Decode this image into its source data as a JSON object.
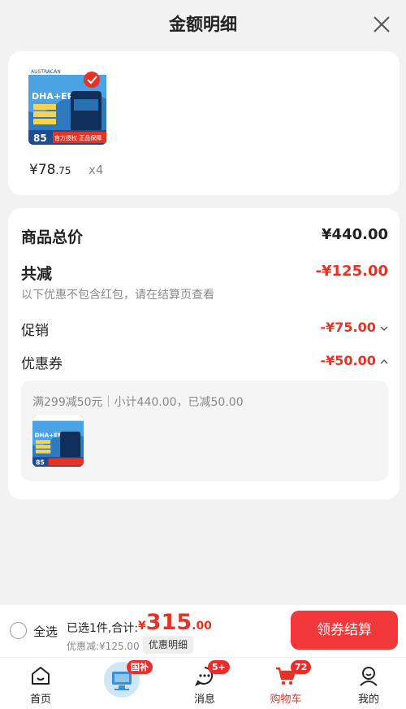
{
  "header": {
    "title": "金额明细"
  },
  "product": {
    "price_currency": "¥",
    "price_int": "78",
    "price_dec": ".75",
    "quantity": "x4",
    "image": {
      "brand": "AUSTRACAN",
      "label": "DHA+EPA",
      "badge": "85",
      "footer": "官方授权 正品保障"
    }
  },
  "summary": {
    "total_label": "商品总价",
    "total_value": "¥440.00",
    "discount_label": "共减",
    "discount_value": "-¥125.00",
    "note": "以下优惠不包含红包，请在结算页查看",
    "promo_label": "促销",
    "promo_value": "-¥75.00",
    "coupon_label": "优惠券",
    "coupon_value": "-¥50.00",
    "coupon_detail": "满299减50元｜小计440.00，已减50.00"
  },
  "bottom_bar": {
    "select_all": "全选",
    "selected_text": "已选1件,合计:",
    "total_currency": "¥",
    "total_int": "315",
    "total_dec": ".00",
    "discount_text": "优惠减:¥125.00",
    "detail_tag": "优惠明细",
    "checkout": "领券结算"
  },
  "tabbar": {
    "items": [
      {
        "label": "首页",
        "icon": "home-icon"
      },
      {
        "label": "",
        "icon": "national-subsidy-icon",
        "badge": "国补"
      },
      {
        "label": "消息",
        "icon": "message-icon",
        "badge": "5+"
      },
      {
        "label": "购物车",
        "icon": "cart-icon",
        "badge": "72",
        "active": true
      },
      {
        "label": "我的",
        "icon": "profile-icon"
      }
    ]
  },
  "colors": {
    "accent": "#e53426",
    "button": "#f3383b",
    "background": "#f2f2f2"
  }
}
